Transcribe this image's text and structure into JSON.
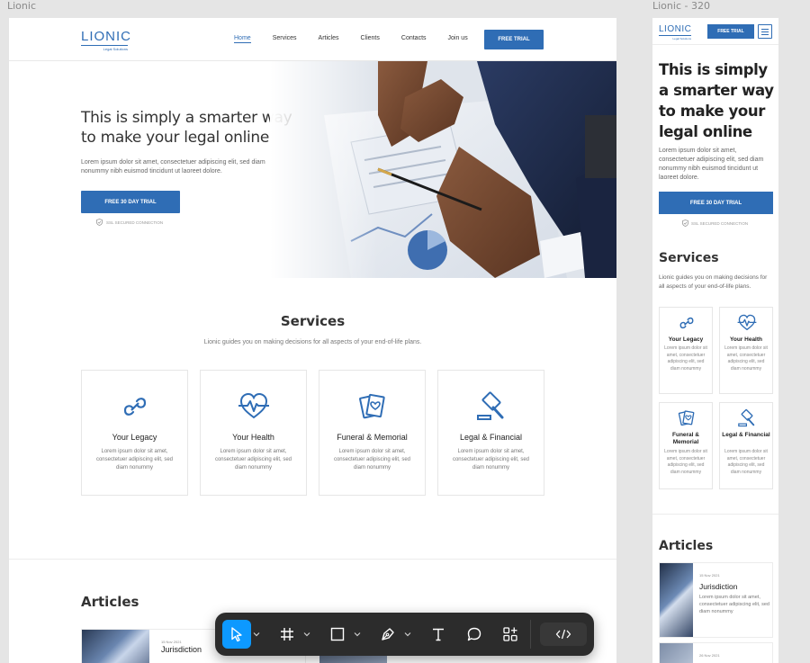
{
  "frames": {
    "desktop_label": "Lionic",
    "mobile_label": "Lionic - 320"
  },
  "brand": {
    "name": "LIONIC",
    "tagline": "Legal Solutions",
    "accent": "#2f6db5"
  },
  "nav": {
    "links": [
      "Home",
      "Services",
      "Articles",
      "Clients",
      "Contacts",
      "Join us"
    ],
    "active": "Home",
    "cta": "FREE TRIAL"
  },
  "hero": {
    "title": "This is simply a smarter way to make your legal online",
    "text": "Lorem ipsum dolor sit amet, consectetuer adipiscing elit, sed diam nonummy nibh euismod tincidunt ut laoreet dolore.",
    "cta": "FREE 30 DAY TRIAL",
    "secure": "SSL SECURED CONNECTION"
  },
  "services": {
    "title": "Services",
    "subtitle": "Lionic guides you on making decisions for all aspects of your end-of-life plans.",
    "items": [
      {
        "title": "Your Legacy",
        "text": "Lorem ipsum dolor sit amet, consectetuer adipiscing elit, sed diam nonummy",
        "icon": "infinity-icon"
      },
      {
        "title": "Your Health",
        "text": "Lorem ipsum dolor sit amet, consectetuer adipiscing elit, sed diam nonummy",
        "icon": "heart-pulse-icon"
      },
      {
        "title": "Funeral & Memorial",
        "text": "Lorem ipsum dolor sit amet, consectetuer adipiscing elit, sed diam nonummy",
        "icon": "memorial-cards-icon"
      },
      {
        "title": "Legal & Financial",
        "text": "Lorem ipsum dolor sit amet, consectetuer adipiscing elit, sed diam nonummy",
        "icon": "gavel-icon"
      }
    ]
  },
  "articles": {
    "title": "Articles",
    "items": [
      {
        "date": "15 Nov 2021",
        "title": "Jurisdiction",
        "text": "Lorem ipsum dolor sit amet, consectetuer adipiscing elit, sed diam nonummy"
      },
      {
        "date": "26 Nov 2021"
      }
    ]
  },
  "toolbar": {
    "tools": [
      "move-tool",
      "frame-tool",
      "rectangle-tool",
      "pen-tool",
      "text-tool",
      "comment-tool",
      "actions-tool",
      "dev-mode-toggle"
    ],
    "active": "move-tool",
    "active_color": "#0d99ff"
  }
}
